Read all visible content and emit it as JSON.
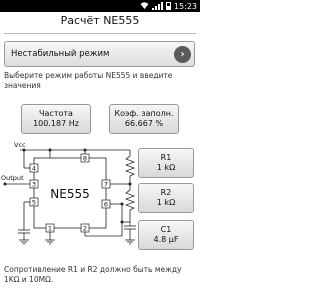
{
  "status_bar": {
    "time": "15:23"
  },
  "header": {
    "title": "Расчёт NE555"
  },
  "mode_select": {
    "selected": "Нестабильный режим"
  },
  "hint": "Выберите режим работы NE555 и введите значения",
  "outputs": {
    "frequency_label": "Частота",
    "frequency_value": "100.187 Hz",
    "duty_label": "Коэф. заполн.",
    "duty_value": "66.667 %"
  },
  "schematic": {
    "chip_label": "NE555",
    "vcc_label": "Vcc",
    "output_label": "Output",
    "pins": [
      "4",
      "8",
      "3",
      "7",
      "6",
      "5",
      "1",
      "2"
    ]
  },
  "components": {
    "r1_label": "R1",
    "r1_value": "1 kΩ",
    "r2_label": "R2",
    "r2_value": "1 kΩ",
    "c1_label": "C1",
    "c1_value": "4.8 μF"
  },
  "footer": "Сопротивление R1 и R2 должно быть между 1KΩ и 10MΩ."
}
